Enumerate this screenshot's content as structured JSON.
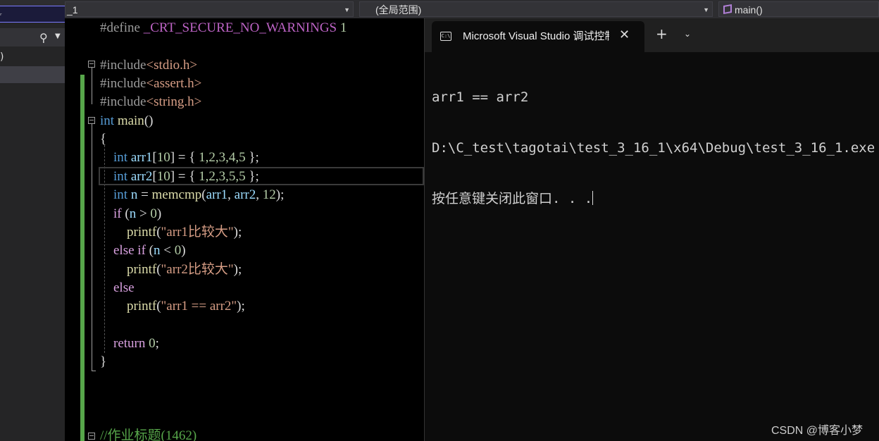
{
  "left_panel": {
    "box_glyph": "ᵣ",
    "paren_text": ")"
  },
  "nav": {
    "project_suffix": "_1",
    "scope": "(全局范围)",
    "member": "main()"
  },
  "editor": {
    "lines": [
      {
        "parts": [
          [
            "pp",
            "#define "
          ],
          [
            "mac",
            "_CRT_SECURE_NO_WARNINGS"
          ],
          [
            "num",
            " 1"
          ]
        ]
      },
      {
        "parts": []
      },
      {
        "parts": [
          [
            "pp",
            "#include"
          ],
          [
            "inc",
            "<stdio.h>"
          ]
        ]
      },
      {
        "parts": [
          [
            "pp",
            "#include"
          ],
          [
            "inc",
            "<assert.h>"
          ]
        ]
      },
      {
        "parts": [
          [
            "pp",
            "#include"
          ],
          [
            "inc",
            "<string.h>"
          ]
        ]
      },
      {
        "parts": [
          [
            "kw",
            "int"
          ],
          [
            "pun",
            " "
          ],
          [
            "fn",
            "main"
          ],
          [
            "pun",
            "()"
          ]
        ]
      },
      {
        "parts": [
          [
            "pun",
            "{"
          ]
        ]
      },
      {
        "parts": [
          [
            "pun",
            "    "
          ],
          [
            "kw",
            "int"
          ],
          [
            "pun",
            " "
          ],
          [
            "var",
            "arr1"
          ],
          [
            "pun",
            "["
          ],
          [
            "num",
            "10"
          ],
          [
            "pun",
            "] = { "
          ],
          [
            "num",
            "1,2,3,4,5"
          ],
          [
            "pun",
            " };"
          ]
        ]
      },
      {
        "parts": [
          [
            "pun",
            "    "
          ],
          [
            "kw",
            "int"
          ],
          [
            "pun",
            " "
          ],
          [
            "var",
            "arr2"
          ],
          [
            "pun",
            "["
          ],
          [
            "num",
            "10"
          ],
          [
            "pun",
            "] = { "
          ],
          [
            "num",
            "1,2,3,5,5"
          ],
          [
            "pun",
            " };"
          ]
        ]
      },
      {
        "parts": [
          [
            "pun",
            "    "
          ],
          [
            "kw",
            "int"
          ],
          [
            "pun",
            " "
          ],
          [
            "var",
            "n"
          ],
          [
            "pun",
            " = "
          ],
          [
            "fn",
            "memcmp"
          ],
          [
            "pun",
            "("
          ],
          [
            "var",
            "arr1"
          ],
          [
            "pun",
            ", "
          ],
          [
            "var",
            "arr2"
          ],
          [
            "pun",
            ", "
          ],
          [
            "num",
            "12"
          ],
          [
            "pun",
            ");"
          ]
        ]
      },
      {
        "parts": [
          [
            "pun",
            "    "
          ],
          [
            "ctl",
            "if"
          ],
          [
            "pun",
            " ("
          ],
          [
            "var",
            "n"
          ],
          [
            "pun",
            " > "
          ],
          [
            "num",
            "0"
          ],
          [
            "pun",
            ")"
          ]
        ]
      },
      {
        "parts": [
          [
            "pun",
            "        "
          ],
          [
            "fn",
            "printf"
          ],
          [
            "pun",
            "("
          ],
          [
            "str",
            "\"arr1比较大\""
          ],
          [
            "pun",
            ");"
          ]
        ]
      },
      {
        "parts": [
          [
            "pun",
            "    "
          ],
          [
            "ctl",
            "else if"
          ],
          [
            "pun",
            " ("
          ],
          [
            "var",
            "n"
          ],
          [
            "pun",
            " < "
          ],
          [
            "num",
            "0"
          ],
          [
            "pun",
            ")"
          ]
        ]
      },
      {
        "parts": [
          [
            "pun",
            "        "
          ],
          [
            "fn",
            "printf"
          ],
          [
            "pun",
            "("
          ],
          [
            "str",
            "\"arr2比较大\""
          ],
          [
            "pun",
            ");"
          ]
        ]
      },
      {
        "parts": [
          [
            "pun",
            "    "
          ],
          [
            "ctl",
            "else"
          ]
        ]
      },
      {
        "parts": [
          [
            "pun",
            "        "
          ],
          [
            "fn",
            "printf"
          ],
          [
            "pun",
            "("
          ],
          [
            "str",
            "\"arr1 == arr2\""
          ],
          [
            "pun",
            ");"
          ]
        ]
      },
      {
        "parts": []
      },
      {
        "parts": [
          [
            "pun",
            "    "
          ],
          [
            "ctl",
            "return"
          ],
          [
            "pun",
            " "
          ],
          [
            "num",
            "0"
          ],
          [
            "pun",
            ";"
          ]
        ]
      },
      {
        "parts": [
          [
            "pun",
            "}"
          ]
        ]
      }
    ],
    "bottom_line": {
      "parts": [
        [
          "cmt",
          "//作业标题(1462)"
        ]
      ]
    }
  },
  "terminal": {
    "tab_icon": "C:\\",
    "tab_title": "Microsoft Visual Studio 调试控制台",
    "close_glyph": "✕",
    "new_tab_glyph": "+",
    "menu_glyph": "⌄",
    "lines": [
      "arr1 == arr2",
      "D:\\C_test\\tagotai\\test_3_16_1\\x64\\Debug\\test_3_16_1.exe",
      "按任意键关闭此窗口. . ."
    ]
  },
  "watermark": "CSDN @博客小梦",
  "colors": {
    "editor_bg": "#000000",
    "terminal_bg": "#0c0c0c",
    "change_bar": "#57a64a",
    "keyword": "#569cd6"
  }
}
